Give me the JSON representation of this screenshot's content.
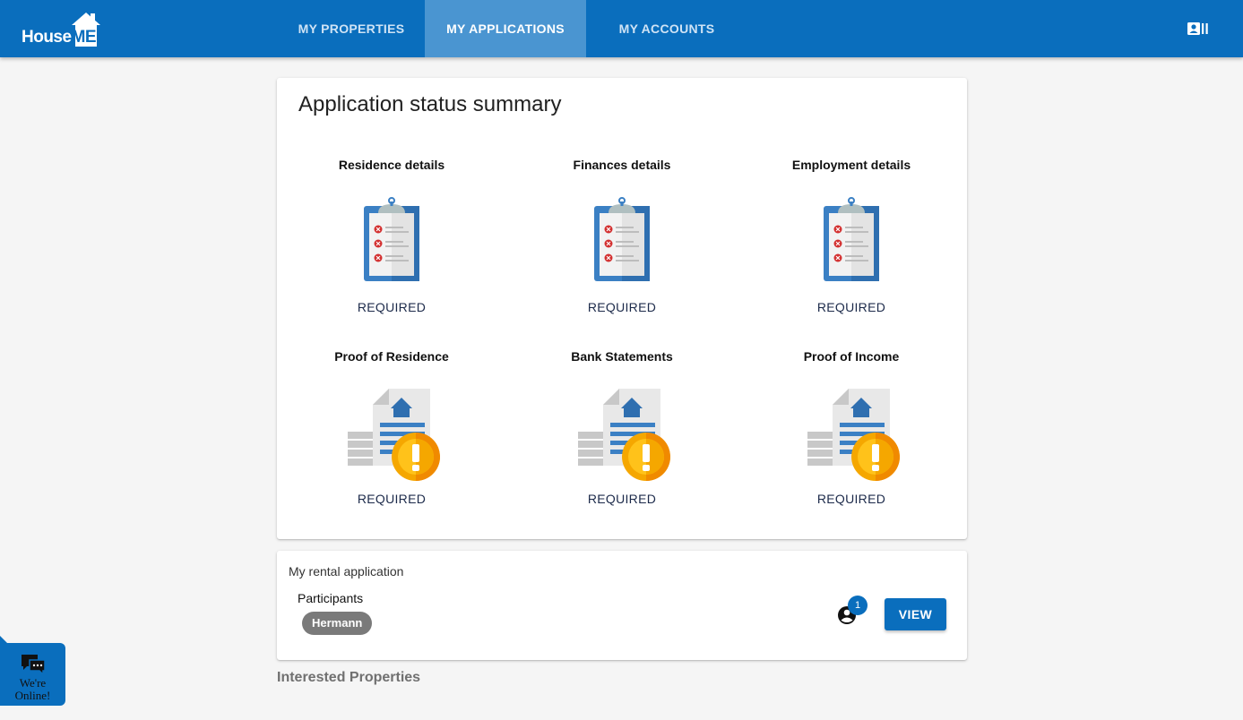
{
  "brand": {
    "name_part1": "House",
    "name_part2": "ME"
  },
  "nav": [
    {
      "label": "MY PROPERTIES"
    },
    {
      "label": "MY APPLICATIONS",
      "active": true
    },
    {
      "label": "MY ACCOUNTS"
    }
  ],
  "header_icon": "contact-card-icon",
  "summary": {
    "title": "Application status summary",
    "tiles": [
      {
        "label": "Residence details",
        "status": "REQUIRED",
        "icon": "clipboard-checklist-icon"
      },
      {
        "label": "Finances details",
        "status": "REQUIRED",
        "icon": "clipboard-checklist-icon"
      },
      {
        "label": "Employment details",
        "status": "REQUIRED",
        "icon": "clipboard-checklist-icon"
      },
      {
        "label": "Proof of Residence",
        "status": "REQUIRED",
        "icon": "document-warning-icon"
      },
      {
        "label": "Bank Statements",
        "status": "REQUIRED",
        "icon": "document-warning-icon"
      },
      {
        "label": "Proof of Income",
        "status": "REQUIRED",
        "icon": "document-warning-icon"
      }
    ]
  },
  "rental": {
    "title": "My rental application",
    "participants_label": "Participants",
    "participant": "Hermann",
    "participant_count": "1",
    "view_label": "VIEW"
  },
  "interested_heading": "Interested Properties",
  "chat": {
    "line1": "We're",
    "line2": "Online!"
  },
  "colors": {
    "primary": "#0a6ebd",
    "active_tab": "#4a95d1",
    "warning": "#f5a700",
    "error": "#d32f2f"
  }
}
